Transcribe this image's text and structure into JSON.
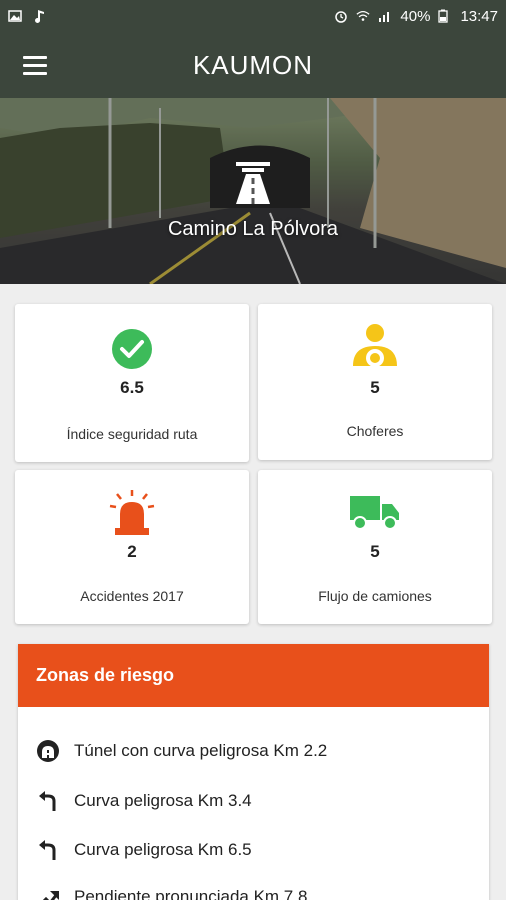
{
  "status_bar": {
    "battery": "40%",
    "time": "13:47"
  },
  "app": {
    "title": "KAUMON"
  },
  "hero": {
    "route_name": "Camino La Pólvora",
    "icon": "highway-icon"
  },
  "stats": [
    {
      "icon": "check-circle-icon",
      "value": "6.5",
      "label": "Índice seguridad ruta",
      "color": "#3dbb5a"
    },
    {
      "icon": "driver-icon",
      "value": "5",
      "label": "Choferes",
      "color": "#f5c518"
    },
    {
      "icon": "siren-icon",
      "value": "2",
      "label": "Accidentes 2017",
      "color": "#e8501b"
    },
    {
      "icon": "truck-icon",
      "value": "5",
      "label": "Flujo de camiones",
      "color": "#3dbb5a"
    }
  ],
  "zones": {
    "title": "Zonas de riesgo",
    "header_color": "#e8501b",
    "items": [
      {
        "icon": "tunnel-icon",
        "label": "Túnel con curva peligrosa Km 2.2"
      },
      {
        "icon": "curve-left-icon",
        "label": "Curva peligrosa Km 3.4"
      },
      {
        "icon": "curve-left-icon",
        "label": "Curva peligrosa Km 6.5"
      },
      {
        "icon": "slope-icon",
        "label": "Pendiente pronunciada Km 7.8"
      }
    ]
  }
}
